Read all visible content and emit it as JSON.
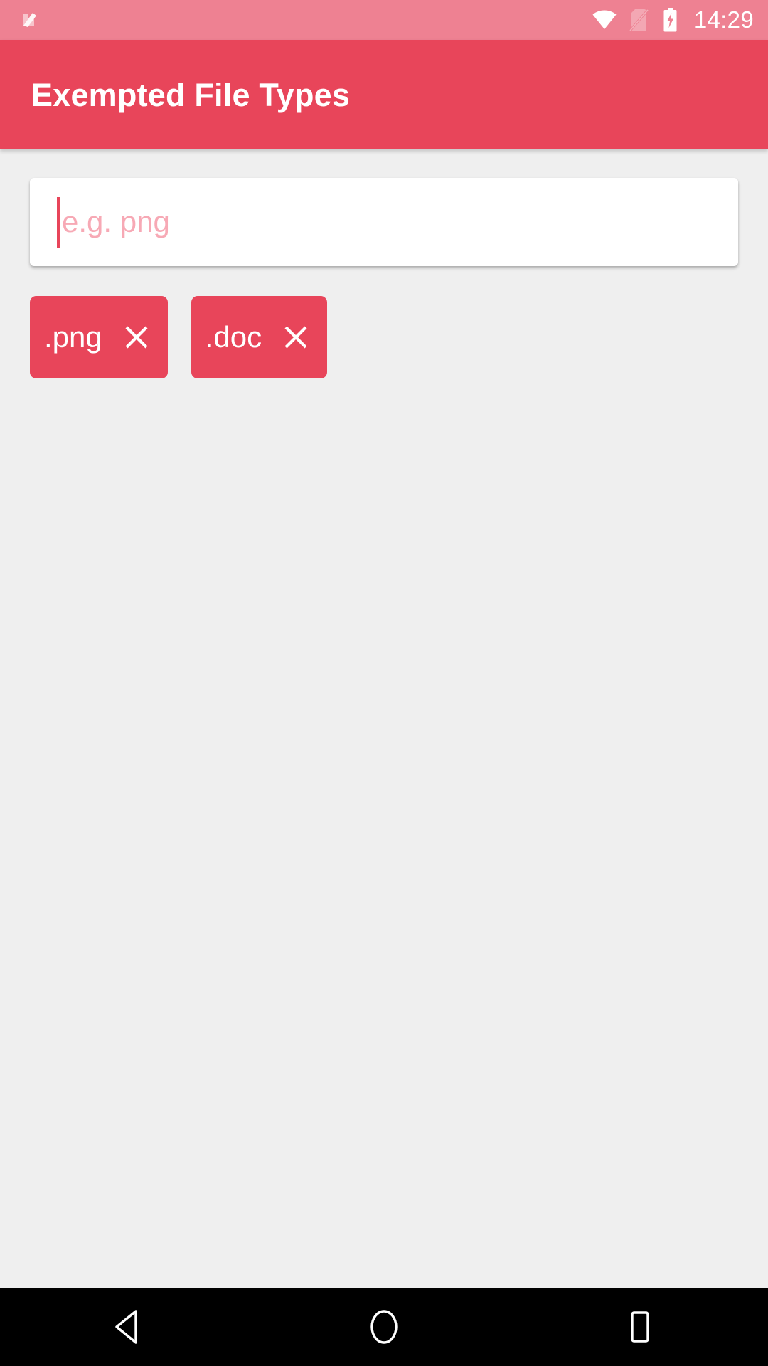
{
  "status_bar": {
    "background_color": "#EE8192",
    "left_icon": "android-nougat-logo",
    "icons": [
      {
        "name": "wifi-icon",
        "state": "full-signal"
      },
      {
        "name": "no-sim-icon",
        "state": "disabled"
      },
      {
        "name": "battery-charging-icon",
        "state": "charging"
      }
    ],
    "clock": "14:29"
  },
  "app_bar": {
    "title": "Exempted File Types",
    "background_color": "#E8455A",
    "text_color": "#FFFFFF"
  },
  "content": {
    "background_color": "#EFEFEF",
    "input": {
      "name": "file-type-input",
      "value": "",
      "placeholder": "e.g. png",
      "placeholder_color": "#F7A9B5",
      "caret_color": "#E8455A",
      "card_color": "#FFFFFF",
      "focused": true
    },
    "chips": [
      {
        "label": ".png",
        "remove_label": "Remove .png",
        "color": "#E8455A"
      },
      {
        "label": ".doc",
        "remove_label": "Remove .doc",
        "color": "#E8455A"
      }
    ]
  },
  "nav_bar": {
    "background_color": "#000000",
    "buttons": [
      {
        "name": "back-button",
        "icon": "triangle-left-icon"
      },
      {
        "name": "home-button",
        "icon": "circle-icon"
      },
      {
        "name": "recents-button",
        "icon": "square-icon"
      }
    ]
  }
}
